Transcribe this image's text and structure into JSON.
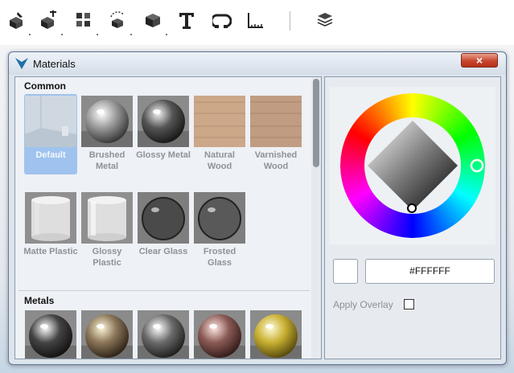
{
  "toolbar": {
    "items": [
      {
        "name": "paint-brush-icon"
      },
      {
        "name": "move-cube-icon"
      },
      {
        "name": "multi-cube-icon"
      },
      {
        "name": "rotate-scale-icon"
      },
      {
        "name": "solid-cube-icon"
      },
      {
        "name": "text-tool-icon"
      },
      {
        "name": "magnet-snap-icon"
      },
      {
        "name": "ruler-measure-icon"
      },
      {
        "name": "layers-stack-icon"
      }
    ]
  },
  "window": {
    "title": "Materials",
    "close_label": "×"
  },
  "library": {
    "sections": [
      {
        "title": "Common",
        "materials": [
          {
            "label": "Default",
            "swatch": "default",
            "selected": true
          },
          {
            "label": "Brushed Metal",
            "swatch": "chrome"
          },
          {
            "label": "Glossy Metal",
            "swatch": "dark-chrome"
          },
          {
            "label": "Natural Wood",
            "swatch": "wood-light"
          },
          {
            "label": "Varnished Wood",
            "swatch": "wood"
          },
          {
            "label": "Matte Plastic",
            "swatch": "cylinder"
          },
          {
            "label": "Glossy Plastic",
            "swatch": "cylinder-gloss"
          },
          {
            "label": "Clear Glass",
            "swatch": "glass-clear"
          },
          {
            "label": "Frosted Glass",
            "swatch": "glass-frost"
          }
        ]
      },
      {
        "title": "Metals",
        "materials": [
          {
            "label": "",
            "swatch": "metal-dark"
          },
          {
            "label": "",
            "swatch": "metal-bronze"
          },
          {
            "label": "",
            "swatch": "metal-steel"
          },
          {
            "label": "",
            "swatch": "metal-copper"
          },
          {
            "label": "",
            "swatch": "metal-gold"
          }
        ]
      }
    ]
  },
  "color_panel": {
    "hex_value": "#FFFFFF",
    "swatch_color": "#ffffff",
    "apply_overlay_label": "Apply Overlay",
    "apply_overlay_checked": false
  }
}
